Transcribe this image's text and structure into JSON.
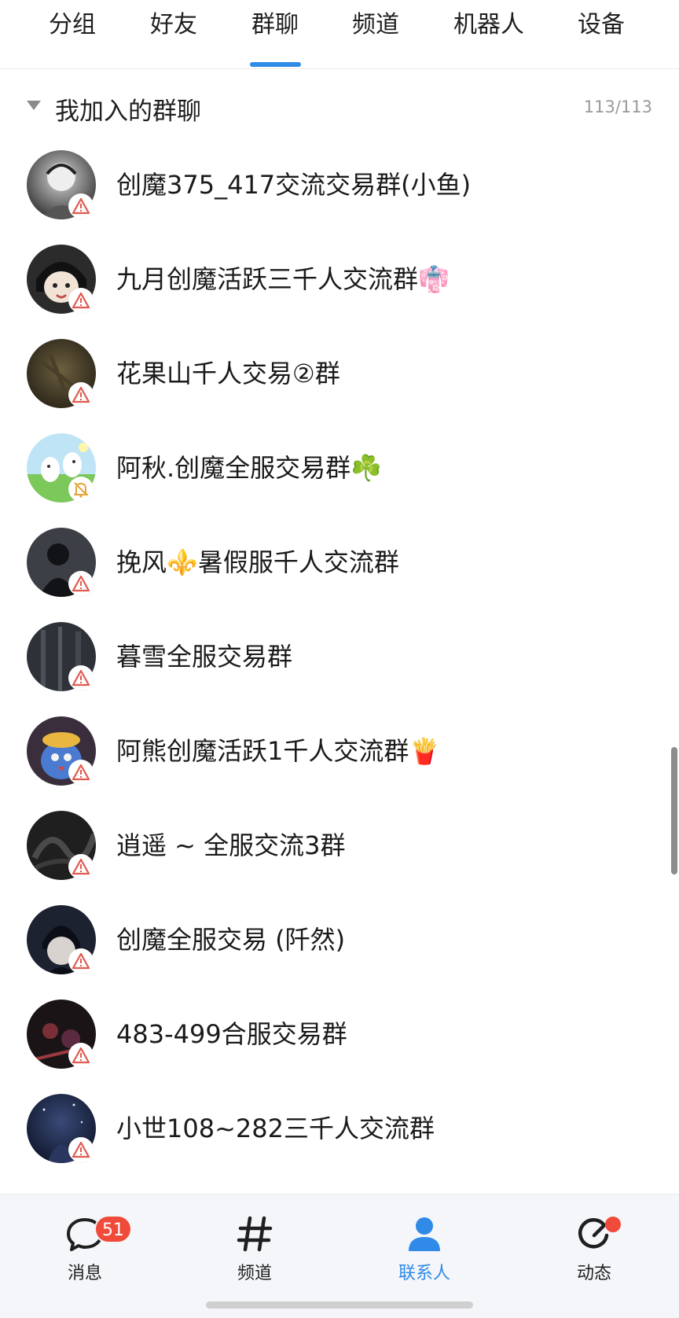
{
  "tabs": [
    {
      "label": "分组"
    },
    {
      "label": "好友"
    },
    {
      "label": "群聊",
      "active": true
    },
    {
      "label": "频道"
    },
    {
      "label": "机器人"
    },
    {
      "label": "设备"
    }
  ],
  "group": {
    "title": "我加入的群聊",
    "count": "113/113"
  },
  "groups": [
    {
      "name": "创魔375_417交流交易群(小鱼)",
      "avatar": "dark-sketch",
      "status": "warning-icon"
    },
    {
      "name": "九月创魔活跃三千人交流群👘",
      "avatar": "anime-boy",
      "status": "warning-icon"
    },
    {
      "name": "花果山千人交易②群",
      "avatar": "brown-scene",
      "status": "warning-icon"
    },
    {
      "name": "阿秋.创魔全服交易群☘️",
      "avatar": "green-cartoon",
      "status": "bell-muted-icon"
    },
    {
      "name": "挽风⚜️暑假服千人交流群",
      "avatar": "dark-figure",
      "status": "warning-icon"
    },
    {
      "name": "暮雪全服交易群",
      "avatar": "dark-forest",
      "status": "warning-icon"
    },
    {
      "name": "阿熊创魔活跃1千人交流群🍟",
      "avatar": "colorful-character",
      "status": "warning-icon"
    },
    {
      "name": "逍遥 ~ 全服交流3群",
      "avatar": "dark-texture",
      "status": "warning-icon"
    },
    {
      "name": "创魔全服交易 (阡然)",
      "avatar": "anime-dark",
      "status": "warning-icon"
    },
    {
      "name": "483-499合服交易群",
      "avatar": "dark-red-scene",
      "status": "warning-icon"
    },
    {
      "name": "小世108~282三千人交流群",
      "avatar": "night-sky",
      "status": "warning-icon"
    }
  ],
  "bottom_nav": [
    {
      "label": "消息",
      "icon": "chat-bubble-icon",
      "badge": "51"
    },
    {
      "label": "频道",
      "icon": "hash-icon"
    },
    {
      "label": "联系人",
      "icon": "contact-person-icon",
      "active": true
    },
    {
      "label": "动态",
      "icon": "moments-icon",
      "dot": true
    }
  ],
  "colors": {
    "accent": "#2f8ae8",
    "badge": "#f04a3a",
    "warning": "#e05a4f",
    "mute": "#e5a63a"
  }
}
